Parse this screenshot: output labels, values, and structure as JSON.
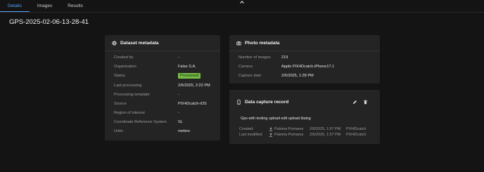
{
  "tabs": [
    {
      "label": "Details",
      "active": true
    },
    {
      "label": "Images",
      "active": false
    },
    {
      "label": "Results",
      "active": false
    }
  ],
  "collapse_icon": "chevron-up-icon",
  "page_title": "GPS-2025-02-06-13-28-41",
  "dataset_metadata": {
    "title": "Dataset metadata",
    "icon": "dataset-icon",
    "rows": [
      {
        "label": "Created by",
        "value": "-"
      },
      {
        "label": "Organization",
        "value": "False S.A."
      },
      {
        "label": "Status",
        "value": "Processed"
      },
      {
        "label": "Last processing",
        "value": "2/6/2025, 2:22 PM"
      },
      {
        "label": "Processing template",
        "value": "-"
      },
      {
        "label": "Source",
        "value": "PIX4Dcatch-iOS"
      },
      {
        "label": "Region of interest",
        "value": "-"
      },
      {
        "label": "Coordinate Reference System",
        "value": "SL"
      },
      {
        "label": "Units",
        "value": "meters"
      }
    ],
    "status_color": "#76bb46"
  },
  "photo_metadata": {
    "title": "Photo metadata",
    "icon": "camera-icon",
    "rows": [
      {
        "label": "Number of images",
        "value": "219"
      },
      {
        "label": "Camera",
        "value": "Apple PIX4Dcatch.iPhone17.1"
      },
      {
        "label": "Capture date",
        "value": "2/6/2025, 1:28 PM"
      }
    ]
  },
  "data_capture": {
    "title": "Data capture record",
    "icon": "phone-icon",
    "edit_icon": "pencil-icon",
    "delete_icon": "trash-icon",
    "description": "Gps with testing upload edit upload dialog",
    "created": {
      "label": "Created:",
      "user": "Paloma Pomares",
      "date": "2/6/2025, 1:57 PM",
      "app": "PIX4Dcatch"
    },
    "modified": {
      "label": "Last modified:",
      "user": "Paloma Pomares",
      "date": "2/6/2025, 1:57 PM",
      "app": "PIX4Dcatch"
    }
  },
  "accent_color": "#5aa0f0"
}
